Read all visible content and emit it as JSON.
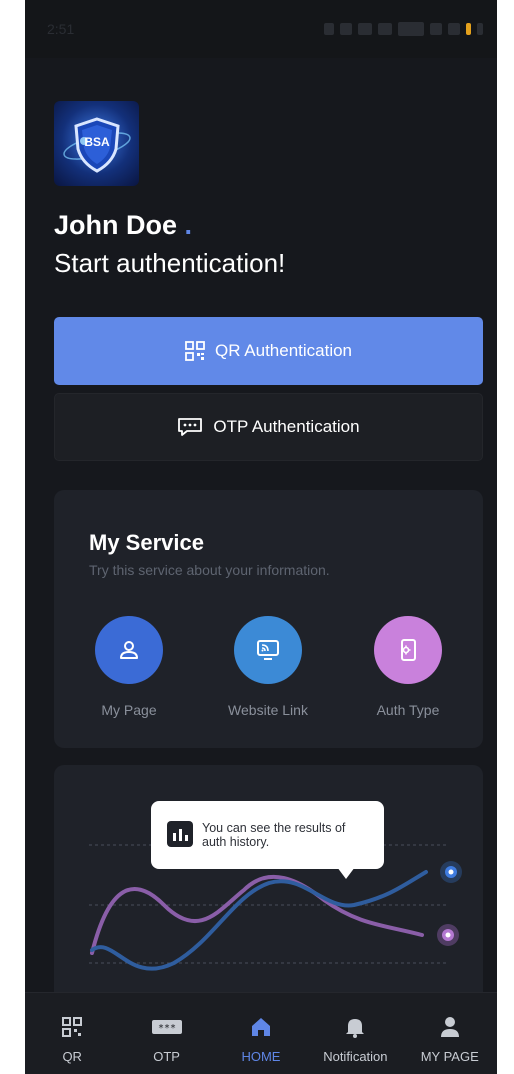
{
  "status_bar": {
    "time": "2:51"
  },
  "logo": {
    "text": "BSA"
  },
  "greeting": {
    "name": "John Doe",
    "dot": ".",
    "subtitle": "Start authentication!"
  },
  "auth_buttons": {
    "qr_label": "QR Authentication",
    "otp_label": "OTP Authentication"
  },
  "my_service": {
    "title": "My Service",
    "subtitle": "Try this service about your information.",
    "items": [
      {
        "label": "My Page",
        "icon": "user-icon",
        "color": "#3b6bd6"
      },
      {
        "label": "Website Link",
        "icon": "monitor-cast-icon",
        "color": "#3c8ad6"
      },
      {
        "label": "Auth Type",
        "icon": "phone-gear-icon",
        "color": "#c981dc"
      }
    ]
  },
  "history_chart": {
    "tooltip": "You can see the results of auth history."
  },
  "bottom_nav": {
    "items": [
      {
        "label": "QR",
        "icon": "qr-icon"
      },
      {
        "label": "OTP",
        "icon": "otp-icon"
      },
      {
        "label": "HOME",
        "icon": "home-icon",
        "active": true
      },
      {
        "label": "Notification",
        "icon": "bell-icon"
      },
      {
        "label": "MY PAGE",
        "icon": "person-icon"
      }
    ]
  },
  "colors": {
    "accent": "#6189e8",
    "background": "#16181d",
    "card": "#1f2229"
  }
}
